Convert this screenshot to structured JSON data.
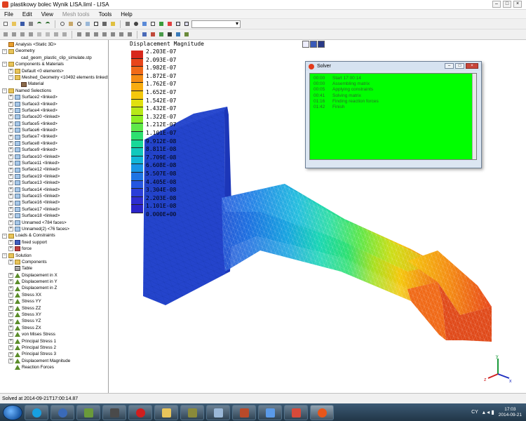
{
  "window": {
    "title": "plastikowy bolec Wynik LISA.liml - LISA"
  },
  "menu": {
    "items": [
      "File",
      "Edit",
      "View",
      "Mesh tools",
      "Tools",
      "Help"
    ]
  },
  "tree": {
    "items": [
      {
        "label": "Analysis <Static 3D>",
        "level": 0,
        "icon": "analysis-icon",
        "expander": "none"
      },
      {
        "label": "Geometry",
        "level": 0,
        "icon": "folder-icon",
        "expander": "minus"
      },
      {
        "label": "cad_geom_plastic_clip_simulate.stp",
        "level": 2,
        "icon": "none",
        "expander": "none"
      },
      {
        "label": "Components & Materials",
        "level": 0,
        "icon": "folder-icon",
        "expander": "minus"
      },
      {
        "label": "Default <0 elements>",
        "level": 1,
        "icon": "folder-icon",
        "expander": "plus"
      },
      {
        "label": "Meshed_Geometry <10492 elements linked>",
        "level": 1,
        "icon": "folder-icon",
        "expander": "minus"
      },
      {
        "label": "Material",
        "level": 2,
        "icon": "material-icon",
        "expander": "none"
      },
      {
        "label": "Named Selections",
        "level": 0,
        "icon": "folder-icon",
        "expander": "minus"
      },
      {
        "label": "Surface2 <linked>",
        "level": 1,
        "icon": "surface-icon",
        "expander": "plus"
      },
      {
        "label": "Surface3 <linked>",
        "level": 1,
        "icon": "surface-icon",
        "expander": "plus"
      },
      {
        "label": "Surface4 <linked>",
        "level": 1,
        "icon": "surface-icon",
        "expander": "plus"
      },
      {
        "label": "Surface20 <linked>",
        "level": 1,
        "icon": "surface-icon",
        "expander": "plus"
      },
      {
        "label": "Surface5 <linked>",
        "level": 1,
        "icon": "surface-icon",
        "expander": "plus"
      },
      {
        "label": "Surface6 <linked>",
        "level": 1,
        "icon": "surface-icon",
        "expander": "plus"
      },
      {
        "label": "Surface7 <linked>",
        "level": 1,
        "icon": "surface-icon",
        "expander": "plus"
      },
      {
        "label": "Surface8 <linked>",
        "level": 1,
        "icon": "surface-icon",
        "expander": "plus"
      },
      {
        "label": "Surface9 <linked>",
        "level": 1,
        "icon": "surface-icon",
        "expander": "plus"
      },
      {
        "label": "Surface10 <linked>",
        "level": 1,
        "icon": "surface-icon",
        "expander": "plus"
      },
      {
        "label": "Surface11 <linked>",
        "level": 1,
        "icon": "surface-icon",
        "expander": "plus"
      },
      {
        "label": "Surface12 <linked>",
        "level": 1,
        "icon": "surface-icon",
        "expander": "plus"
      },
      {
        "label": "Surface19 <linked>",
        "level": 1,
        "icon": "surface-icon",
        "expander": "plus"
      },
      {
        "label": "Surface13 <linked>",
        "level": 1,
        "icon": "surface-icon",
        "expander": "plus"
      },
      {
        "label": "Surface14 <linked>",
        "level": 1,
        "icon": "surface-icon",
        "expander": "plus"
      },
      {
        "label": "Surface15 <linked>",
        "level": 1,
        "icon": "surface-icon",
        "expander": "plus"
      },
      {
        "label": "Surface16 <linked>",
        "level": 1,
        "icon": "surface-icon",
        "expander": "plus"
      },
      {
        "label": "Surface17 <linked>",
        "level": 1,
        "icon": "surface-icon",
        "expander": "plus"
      },
      {
        "label": "Surface18 <linked>",
        "level": 1,
        "icon": "surface-icon",
        "expander": "plus"
      },
      {
        "label": "Unnamed <784 faces>",
        "level": 1,
        "icon": "surface-icon",
        "expander": "plus"
      },
      {
        "label": "Unnamed(2) <76 faces>",
        "level": 1,
        "icon": "surface-icon",
        "expander": "plus"
      },
      {
        "label": "Loads & Constraints",
        "level": 0,
        "icon": "folder-icon",
        "expander": "minus"
      },
      {
        "label": "fixed support",
        "level": 1,
        "icon": "support-icon",
        "expander": "plus"
      },
      {
        "label": "force",
        "level": 1,
        "icon": "force-icon",
        "expander": "plus"
      },
      {
        "label": "Solution",
        "level": 0,
        "icon": "folder-icon",
        "expander": "minus"
      },
      {
        "label": "Components",
        "level": 1,
        "icon": "folder-icon",
        "expander": "plus"
      },
      {
        "label": "Table",
        "level": 1,
        "icon": "table-icon",
        "expander": "none"
      },
      {
        "label": "Displacement in X",
        "level": 1,
        "icon": "result-icon",
        "expander": "plus"
      },
      {
        "label": "Displacement in Y",
        "level": 1,
        "icon": "result-icon",
        "expander": "plus"
      },
      {
        "label": "Displacement in Z",
        "level": 1,
        "icon": "result-icon",
        "expander": "plus"
      },
      {
        "label": "Stress XX",
        "level": 1,
        "icon": "result-icon",
        "expander": "plus"
      },
      {
        "label": "Stress YY",
        "level": 1,
        "icon": "result-icon",
        "expander": "plus"
      },
      {
        "label": "Stress ZZ",
        "level": 1,
        "icon": "result-icon",
        "expander": "plus"
      },
      {
        "label": "Stress XY",
        "level": 1,
        "icon": "result-icon",
        "expander": "plus"
      },
      {
        "label": "Stress YZ",
        "level": 1,
        "icon": "result-icon",
        "expander": "plus"
      },
      {
        "label": "Stress ZX",
        "level": 1,
        "icon": "result-icon",
        "expander": "plus"
      },
      {
        "label": "von Mises Stress",
        "level": 1,
        "icon": "result-icon",
        "expander": "plus"
      },
      {
        "label": "Principal Stress 1",
        "level": 1,
        "icon": "result-icon",
        "expander": "plus"
      },
      {
        "label": "Principal Stress 2",
        "level": 1,
        "icon": "result-icon",
        "expander": "plus"
      },
      {
        "label": "Principal Stress 3",
        "level": 1,
        "icon": "result-icon",
        "expander": "plus"
      },
      {
        "label": "Displacement Magnitude",
        "level": 1,
        "icon": "result-icon",
        "expander": "plus"
      },
      {
        "label": "Reaction Forces",
        "level": 1,
        "icon": "result-icon",
        "expander": "none"
      }
    ]
  },
  "legend": {
    "title": "Displacement Magnitude",
    "labels": [
      "2.203E-07",
      "2.093E-07",
      "1.982E-07",
      "1.872E-07",
      "1.762E-07",
      "1.652E-07",
      "1.542E-07",
      "1.432E-07",
      "1.322E-07",
      "1.212E-07",
      "1.101E-07",
      "9.912E-08",
      "8.811E-08",
      "7.709E-08",
      "6.608E-08",
      "5.507E-08",
      "4.405E-08",
      "3.304E-08",
      "2.203E-08",
      "1.101E-08",
      "0.000E+00"
    ],
    "colors": [
      "#d8281c",
      "#e8461a",
      "#f06a18",
      "#f48c14",
      "#f8ac10",
      "#f4c80c",
      "#e0e010",
      "#b8e818",
      "#8ced22",
      "#5ee84a",
      "#2ee070",
      "#18d898",
      "#12c8bc",
      "#12b6d8",
      "#1896e6",
      "#1e74e4",
      "#2456e0",
      "#2a3ed8",
      "#2e2ed0",
      "#2a24c8"
    ]
  },
  "solver": {
    "title": "Solver",
    "log": [
      {
        "time": "00:00",
        "message": "Start 17:00:14"
      },
      {
        "time": "00:00",
        "message": "Assembling matrix"
      },
      {
        "time": "00:05",
        "message": "Applying constraints"
      },
      {
        "time": "00:41",
        "message": "Solving matrix"
      },
      {
        "time": "01:16",
        "message": "Finding reaction forces"
      },
      {
        "time": "01:42",
        "message": "Finish"
      }
    ],
    "background": "#00ff00"
  },
  "triad": {
    "axis_x": "x",
    "axis_y": "y",
    "axis_z": "z"
  },
  "status": {
    "text": "Solved at 2014-09-21T17:00:14.87"
  },
  "taskbar": {
    "language": "CY",
    "time": "17:03",
    "date": "2014-09-21"
  }
}
